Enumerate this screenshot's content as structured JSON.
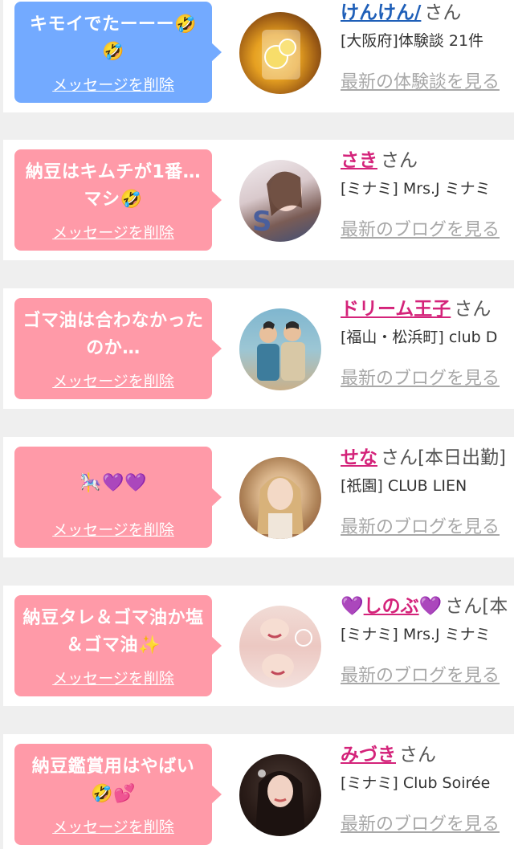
{
  "delete_label": "メッセージを削除",
  "colors": {
    "bubble_pink": "#ff9aa8",
    "bubble_blue": "#73aaff",
    "name_pink": "#d4237a",
    "name_blue": "#1f5fb8",
    "link_gray": "#a8a8a8"
  },
  "items": [
    {
      "message": "キモイでたーーー🤣🤣",
      "delete": "メッセージを削除",
      "name": "けんけん/",
      "name_suffix": "さん",
      "info": "[大阪府]体験談 21件",
      "latest": "最新の体験談を見る",
      "bubble_color": "blue",
      "avatar_icon": "lemon-drink-avatar-photo"
    },
    {
      "message": "納豆はキムチが1番…マシ🤣",
      "delete": "メッセージを削除",
      "name": "さき",
      "name_suffix": "さん",
      "info": "[ミナミ] Mrs.J ミナミ",
      "latest": "最新のブログを見る",
      "bubble_color": "pink",
      "avatar_icon": "woman-avatar-photo"
    },
    {
      "message": "ゴマ油は合わなかったのか…",
      "delete": "メッセージを削除",
      "name": "ドリーム王子",
      "name_suffix": "さん",
      "info": "[福山・松浜町]  club D",
      "latest": "最新のブログを見る",
      "bubble_color": "pink",
      "avatar_icon": "illustration-avatar-photo"
    },
    {
      "message": "🎠💜💜",
      "delete": "メッセージを削除",
      "name": "せな",
      "name_suffix": "さん[本日出勤]",
      "info": "[祇園] CLUB LIEN",
      "latest": "最新のブログを見る",
      "bubble_color": "pink",
      "avatar_icon": "blonde-woman-avatar-photo"
    },
    {
      "message": "納豆タレ＆ゴマ油か塩＆ゴマ油✨",
      "delete": "メッセージを削除",
      "name_heart_left": "💜",
      "name": "しのぶ",
      "name_heart_right": "💜",
      "name_suffix": "さん[本",
      "info": "[ミナミ] Mrs.J ミナミ",
      "latest": "最新のブログを見る",
      "bubble_color": "pink",
      "avatar_icon": "smiling-woman-avatar-photo"
    },
    {
      "message": "納豆鑑賞用はやばい🤣💕",
      "delete": "メッセージを削除",
      "name": "みづき",
      "name_suffix": "さん",
      "info": "[ミナミ] Club Soirée",
      "latest": "最新のブログを見る",
      "bubble_color": "pink",
      "avatar_icon": "dark-hair-woman-avatar-photo"
    }
  ]
}
